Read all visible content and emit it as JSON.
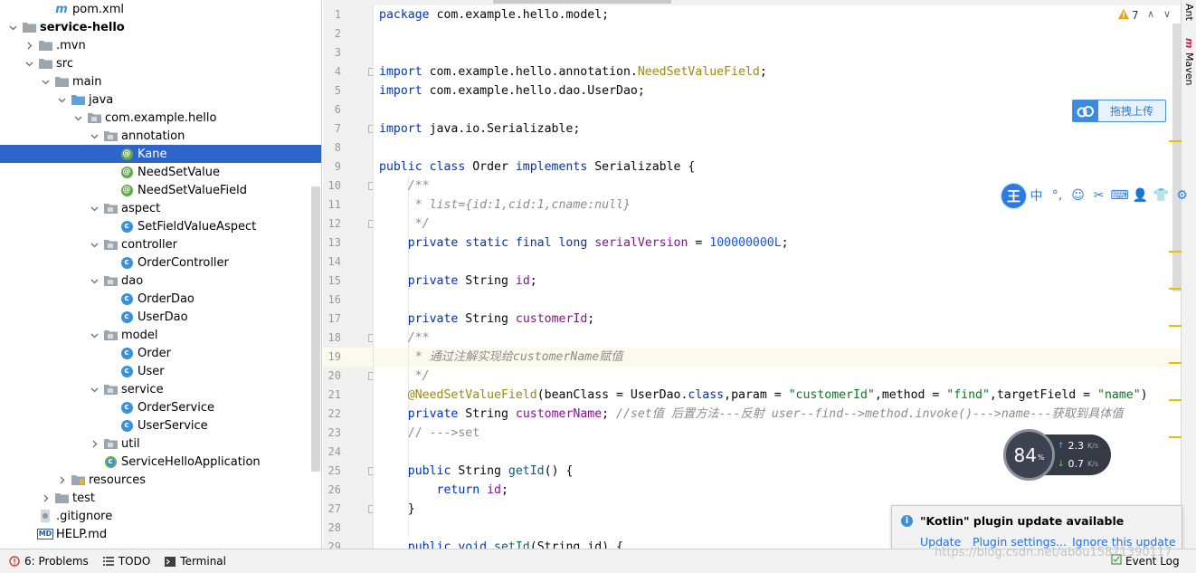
{
  "tree": {
    "items": [
      {
        "label": "pom.xml",
        "icon": "maven-icon",
        "depth": 2,
        "arrow": "none"
      },
      {
        "label": "service-hello",
        "icon": "folder-icon",
        "depth": 0,
        "arrow": "open",
        "bold": true
      },
      {
        "label": ".mvn",
        "icon": "folder-icon",
        "depth": 1,
        "arrow": "closed"
      },
      {
        "label": "src",
        "icon": "folder-icon",
        "depth": 1,
        "arrow": "open"
      },
      {
        "label": "main",
        "icon": "folder-icon",
        "depth": 2,
        "arrow": "open"
      },
      {
        "label": "java",
        "icon": "source-folder-icon",
        "depth": 3,
        "arrow": "open"
      },
      {
        "label": "com.example.hello",
        "icon": "package-icon",
        "depth": 4,
        "arrow": "open"
      },
      {
        "label": "annotation",
        "icon": "package-icon",
        "depth": 5,
        "arrow": "open"
      },
      {
        "label": "Kane",
        "icon": "annotation-icon",
        "depth": 6,
        "arrow": "none",
        "selected": true
      },
      {
        "label": "NeedSetValue",
        "icon": "annotation-icon",
        "depth": 6,
        "arrow": "none"
      },
      {
        "label": "NeedSetValueField",
        "icon": "annotation-icon",
        "depth": 6,
        "arrow": "none"
      },
      {
        "label": "aspect",
        "icon": "package-icon",
        "depth": 5,
        "arrow": "open"
      },
      {
        "label": "SetFieldValueAspect",
        "icon": "class-icon",
        "depth": 6,
        "arrow": "none"
      },
      {
        "label": "controller",
        "icon": "package-icon",
        "depth": 5,
        "arrow": "open"
      },
      {
        "label": "OrderController",
        "icon": "class-icon",
        "depth": 6,
        "arrow": "none"
      },
      {
        "label": "dao",
        "icon": "package-icon",
        "depth": 5,
        "arrow": "open"
      },
      {
        "label": "OrderDao",
        "icon": "class-icon",
        "depth": 6,
        "arrow": "none"
      },
      {
        "label": "UserDao",
        "icon": "class-icon",
        "depth": 6,
        "arrow": "none"
      },
      {
        "label": "model",
        "icon": "package-icon",
        "depth": 5,
        "arrow": "open"
      },
      {
        "label": "Order",
        "icon": "class-icon",
        "depth": 6,
        "arrow": "none"
      },
      {
        "label": "User",
        "icon": "class-icon",
        "depth": 6,
        "arrow": "none"
      },
      {
        "label": "service",
        "icon": "package-icon",
        "depth": 5,
        "arrow": "open"
      },
      {
        "label": "OrderService",
        "icon": "class-icon",
        "depth": 6,
        "arrow": "none"
      },
      {
        "label": "UserService",
        "icon": "class-icon",
        "depth": 6,
        "arrow": "none"
      },
      {
        "label": "util",
        "icon": "package-icon",
        "depth": 5,
        "arrow": "closed"
      },
      {
        "label": "ServiceHelloApplication",
        "icon": "spring-class-icon",
        "depth": 5,
        "arrow": "none"
      },
      {
        "label": "resources",
        "icon": "resources-folder-icon",
        "depth": 3,
        "arrow": "closed"
      },
      {
        "label": "test",
        "icon": "folder-icon",
        "depth": 2,
        "arrow": "closed"
      },
      {
        "label": ".gitignore",
        "icon": "gitignore-icon",
        "depth": 1,
        "arrow": "none"
      },
      {
        "label": "HELP.md",
        "icon": "markdown-icon",
        "depth": 1,
        "arrow": "none"
      }
    ]
  },
  "editor": {
    "line_numbers": [
      "1",
      "2",
      "3",
      "4",
      "5",
      "6",
      "7",
      "8",
      "9",
      "10",
      "11",
      "12",
      "13",
      "14",
      "15",
      "16",
      "17",
      "18",
      "19",
      "20",
      "21",
      "22",
      "23",
      "24",
      "25",
      "26",
      "27",
      "28",
      "29"
    ],
    "current_line": "19",
    "lines": [
      [
        [
          "kw",
          "package "
        ],
        [
          "",
          "com.example.hello.model;"
        ]
      ],
      [],
      [],
      [
        [
          "kw",
          "import "
        ],
        [
          "",
          "com.example.hello.annotation."
        ],
        [
          "ann",
          "NeedSetValueField"
        ],
        [
          "",
          ";"
        ]
      ],
      [
        [
          "kw",
          "import "
        ],
        [
          "",
          "com.example.hello.dao.UserDao;"
        ]
      ],
      [],
      [
        [
          "kw",
          "import "
        ],
        [
          "",
          "java.io.Serializable;"
        ]
      ],
      [],
      [
        [
          "kw",
          "public class "
        ],
        [
          "",
          "Order "
        ],
        [
          "kw",
          "implements "
        ],
        [
          "",
          "Serializable {"
        ]
      ],
      [
        [
          "cmt",
          "    /**"
        ]
      ],
      [
        [
          "cmt",
          "     * list={id:1,cid:1,cname:null}"
        ]
      ],
      [
        [
          "cmt",
          "     */"
        ]
      ],
      [
        [
          "",
          "    "
        ],
        [
          "kw",
          "private static final long "
        ],
        [
          "fld",
          "serialVersion "
        ],
        [
          "",
          "= "
        ],
        [
          "num",
          "100000000L"
        ],
        [
          "",
          ";"
        ]
      ],
      [],
      [
        [
          "",
          "    "
        ],
        [
          "kw",
          "private "
        ],
        [
          "",
          "String "
        ],
        [
          "fld",
          "id"
        ],
        [
          "",
          ";"
        ]
      ],
      [],
      [
        [
          "",
          "    "
        ],
        [
          "kw",
          "private "
        ],
        [
          "",
          "String "
        ],
        [
          "fld",
          "customerId"
        ],
        [
          "",
          ";"
        ]
      ],
      [
        [
          "cmt",
          "    /**"
        ]
      ],
      [
        [
          "cmt",
          "     * 通过注解实现给customerName赋值"
        ]
      ],
      [
        [
          "cmt",
          "     */"
        ]
      ],
      [
        [
          "",
          "    "
        ],
        [
          "ann",
          "@NeedSetValueField"
        ],
        [
          "",
          "(beanClass = UserDao."
        ],
        [
          "kw",
          "class"
        ],
        [
          "",
          ",param = "
        ],
        [
          "str",
          "\"customerId\""
        ],
        [
          "",
          ",method = "
        ],
        [
          "str",
          "\"find\""
        ],
        [
          "",
          ",targetField = "
        ],
        [
          "str",
          "\"name\""
        ],
        [
          "",
          ")"
        ]
      ],
      [
        [
          "",
          "    "
        ],
        [
          "kw",
          "private "
        ],
        [
          "",
          "String "
        ],
        [
          "fld",
          "customerName"
        ],
        [
          "",
          "; "
        ],
        [
          "cmt",
          "//set值 后置方法---反射 user--find-->method.invoke()--->name---获取到具体值"
        ]
      ],
      [
        [
          "cmt2",
          "    // --->set"
        ]
      ],
      [],
      [
        [
          "",
          "    "
        ],
        [
          "kw",
          "public "
        ],
        [
          "",
          "String "
        ],
        [
          "meth",
          "getId"
        ],
        [
          "",
          "() {"
        ]
      ],
      [
        [
          "",
          "        "
        ],
        [
          "kw",
          "return "
        ],
        [
          "fld",
          "id"
        ],
        [
          "",
          ";"
        ]
      ],
      [
        [
          "",
          "    }"
        ]
      ],
      [],
      [
        [
          "",
          "    "
        ],
        [
          "kw",
          "public void "
        ],
        [
          "meth",
          "setId"
        ],
        [
          "",
          "(String id) {"
        ]
      ]
    ],
    "warning_count": "7"
  },
  "right_tools": {
    "ant": "Ant",
    "maven": "Maven"
  },
  "upload": {
    "label": "拖拽上传"
  },
  "ime": {
    "logo": "王",
    "items": [
      "中",
      "°,",
      "☺",
      "✂",
      "⌨",
      "👤",
      "👕",
      "⚙"
    ]
  },
  "netmon": {
    "percent": "84",
    "percent_unit": "%",
    "up": "2.3",
    "down": "0.7",
    "unit": "K/s"
  },
  "notification": {
    "title": "\"Kotlin\" plugin update available",
    "update": "Update",
    "settings": "Plugin settings...",
    "ignore": "Ignore this update"
  },
  "watermark": "https://blog.csdn.net/abou15871390117",
  "statusbar": {
    "problems": "6: Problems",
    "todo": "TODO",
    "terminal": "Terminal",
    "event_log": "Event Log"
  },
  "colors": {
    "selection": "#2f65ca",
    "keyword": "#0033b3",
    "string": "#067d17",
    "annotation": "#9e880d",
    "field": "#871094"
  }
}
